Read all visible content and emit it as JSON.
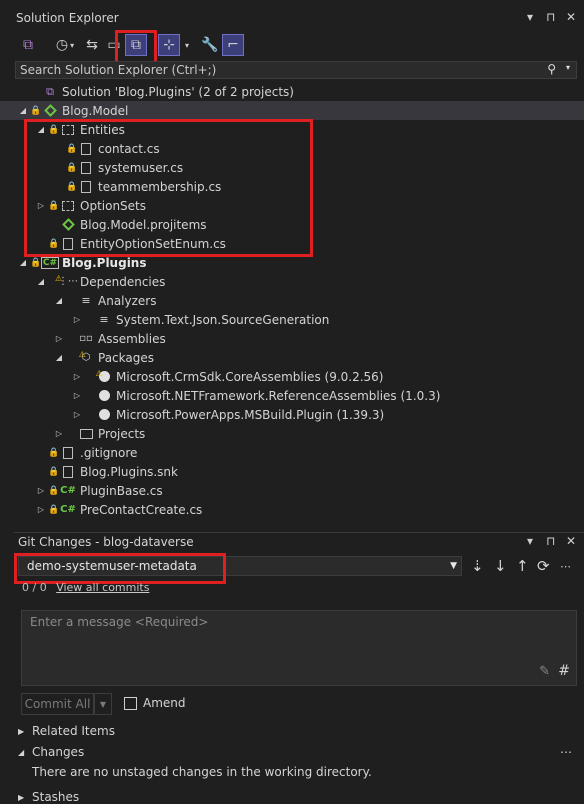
{
  "solution_explorer": {
    "title": "Solution Explorer",
    "title_controls": [
      "▾",
      "⊓",
      "✕"
    ],
    "search_placeholder": "Search Solution Explorer (Ctrl+;)",
    "tree": [
      {
        "label": "Solution 'Blog.Plugins' (2 of 2 projects)",
        "icon": "solution-icon",
        "level": 0,
        "expander": "",
        "lock": false
      },
      {
        "label": "Blog.Model",
        "icon": "shared-project-icon",
        "level": 0,
        "expander": "expanded",
        "lock": true,
        "selected": true
      },
      {
        "label": "Entities",
        "icon": "folder-icon",
        "level": 1,
        "expander": "expanded",
        "lock": true
      },
      {
        "label": "contact.cs",
        "icon": "file-icon",
        "level": 2,
        "expander": "",
        "lock": true
      },
      {
        "label": "systemuser.cs",
        "icon": "file-icon",
        "level": 2,
        "expander": "",
        "lock": true
      },
      {
        "label": "teammembership.cs",
        "icon": "file-icon",
        "level": 2,
        "expander": "",
        "lock": true
      },
      {
        "label": "OptionSets",
        "icon": "folder-icon",
        "level": 1,
        "expander": "collapsed",
        "lock": true
      },
      {
        "label": "Blog.Model.projitems",
        "icon": "shared-project-icon",
        "level": 1,
        "expander": "",
        "lock": false
      },
      {
        "label": "EntityOptionSetEnum.cs",
        "icon": "file-icon",
        "level": 1,
        "expander": "",
        "lock": true
      },
      {
        "label": "Blog.Plugins",
        "icon": "csproj-icon",
        "level": 0,
        "expander": "expanded",
        "lock": true,
        "bold": true
      },
      {
        "label": "Dependencies",
        "icon": "dependencies-icon",
        "level": 1,
        "expander": "expanded",
        "lock": false
      },
      {
        "label": "Analyzers",
        "icon": "analyzers-icon",
        "level": 2,
        "expander": "expanded",
        "lock": false
      },
      {
        "label": "System.Text.Json.SourceGeneration",
        "icon": "analyzers-icon",
        "level": 3,
        "expander": "collapsed",
        "lock": false
      },
      {
        "label": "Assemblies",
        "icon": "assemblies-icon",
        "level": 2,
        "expander": "collapsed",
        "lock": false
      },
      {
        "label": "Packages",
        "icon": "packages-icon",
        "level": 2,
        "expander": "expanded",
        "lock": false
      },
      {
        "label": "Microsoft.CrmSdk.CoreAssemblies (9.0.2.56)",
        "icon": "nuget-warning-icon",
        "level": 3,
        "expander": "collapsed",
        "lock": false
      },
      {
        "label": "Microsoft.NETFramework.ReferenceAssemblies (1.0.3)",
        "icon": "nuget-icon",
        "level": 3,
        "expander": "collapsed",
        "lock": false
      },
      {
        "label": "Microsoft.PowerApps.MSBuild.Plugin (1.39.3)",
        "icon": "nuget-icon",
        "level": 3,
        "expander": "collapsed",
        "lock": false
      },
      {
        "label": "Projects",
        "icon": "folder-solid-icon",
        "level": 2,
        "expander": "collapsed",
        "lock": false
      },
      {
        "label": ".gitignore",
        "icon": "file-icon",
        "level": 1,
        "expander": "",
        "lock": true
      },
      {
        "label": "Blog.Plugins.snk",
        "icon": "key-file-icon",
        "level": 1,
        "expander": "",
        "lock": true
      },
      {
        "label": "PluginBase.cs",
        "icon": "csharp-icon",
        "level": 1,
        "expander": "collapsed",
        "lock": true
      },
      {
        "label": "PreContactCreate.cs",
        "icon": "csharp-icon",
        "level": 1,
        "expander": "collapsed",
        "lock": true
      }
    ]
  },
  "git_changes": {
    "title": "Git Changes - blog-dataverse",
    "title_controls": [
      "▾",
      "⊓",
      "✕"
    ],
    "branch": "demo-systemuser-metadata",
    "sync_counts": "0 / 0",
    "view_all_commits": "View all commits",
    "message_placeholder": "Enter a message <Required>",
    "commit_all": "Commit All",
    "amend": "Amend",
    "related_items": "Related Items",
    "changes": "Changes",
    "changes_status": "There are no unstaged changes in the working directory.",
    "stashes_partial": "Stashes"
  },
  "colors": {
    "highlight": "#e02020",
    "accent": "#6e70c8",
    "lock": "#4aa3ff"
  }
}
